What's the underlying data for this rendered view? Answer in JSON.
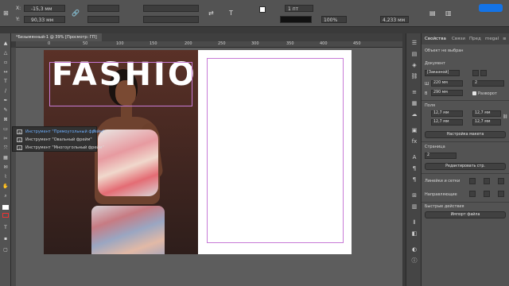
{
  "control_bar": {
    "x_value": "-15,3 мм",
    "y_value": "90,33 мм",
    "stroke_weight": "1 пт",
    "percent": "100%",
    "offset_value": "4,233 мм"
  },
  "document_tab": "*Безымянный-1 @ 39% [Просмотр: ГП]",
  "ruler_ticks": [
    "0",
    "50",
    "100",
    "150",
    "200",
    "250",
    "300",
    "350",
    "400",
    "450"
  ],
  "photo": {
    "headline": "FASHION"
  },
  "tool_flyout": {
    "items": [
      {
        "label": "Инструмент \"Прямоугольный фрейм\"",
        "shortcut": "F"
      },
      {
        "label": "Инструмент \"Овальный фрейм\""
      },
      {
        "label": "Инструмент \"Многоугольный фрейм\""
      }
    ]
  },
  "panel": {
    "tabs": [
      "Свойства",
      "Связи",
      "Пред",
      "megal"
    ],
    "no_selection": "Объект не выбран",
    "document_label": "Документ",
    "preset": "[Заказной]",
    "width": "220 мм",
    "height": "290 мм",
    "pages": "2",
    "spread_label": "Разворот",
    "margins_label": "Поля",
    "margin_top": "12,7 мм",
    "margin_bottom": "12,7 мм",
    "margin_inside": "12,7 мм",
    "margin_outside": "12,7 мм",
    "layout_button": "Настройка макета",
    "page_label": "Страница",
    "page_value": "2",
    "edit_page_button": "Редактировать стр.",
    "rulers_label": "Линейки и сетки",
    "guides_label": "Направляющие",
    "quick_actions_label": "Быстрые действия",
    "import_button": "Импорт файла"
  }
}
